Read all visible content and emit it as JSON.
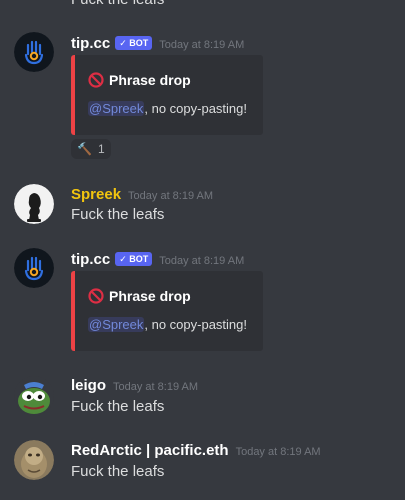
{
  "messages": [
    {
      "partial_text": "Fuck the leafs"
    },
    {
      "username": "tip.cc",
      "bot_tag": "✓ BOT",
      "timestamp": "Today at 8:19 AM",
      "embed": {
        "title": "Phrase drop",
        "mention": "@Spreek",
        "text": ", no copy-pasting!"
      },
      "reaction": {
        "icon": "hammer-icon",
        "emoji": "🔨",
        "count": "1"
      }
    },
    {
      "username": "Spreek",
      "username_color": "#f1c40f",
      "timestamp": "Today at 8:19 AM",
      "text": "Fuck the leafs"
    },
    {
      "username": "tip.cc",
      "bot_tag": "✓ BOT",
      "timestamp": "Today at 8:19 AM",
      "embed": {
        "title": "Phrase drop",
        "mention": "@Spreek",
        "text": ", no copy-pasting!"
      }
    },
    {
      "username": "leigo",
      "timestamp": "Today at 8:19 AM",
      "text": "Fuck the leafs"
    },
    {
      "username": "RedArctic | pacific.eth",
      "timestamp": "Today at 8:19 AM",
      "text": "Fuck the leafs"
    }
  ],
  "colors": {
    "background": "#36393f",
    "embed_background": "#2f3136",
    "embed_accent": "#ed4245",
    "bot_tag": "#5865f2",
    "mention": "#7289da"
  }
}
